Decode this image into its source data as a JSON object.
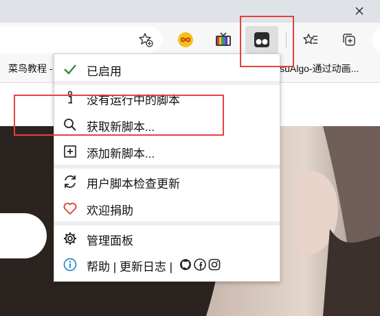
{
  "toolbar": {
    "extension_icons": [
      "favorite-star-plus-icon",
      "infinity-extension-icon",
      "tv-extension-icon",
      "tampermonkey-extension-icon",
      "favorites-icon",
      "collections-icon"
    ]
  },
  "bookmarks": {
    "left": "菜鸟教程 -",
    "right": "isuAlgo-通过动画..."
  },
  "menu": {
    "items": [
      {
        "label": "已启用",
        "icon": "checkmark-icon"
      },
      {
        "label": "没有运行中的脚本",
        "icon": "info-figure-icon"
      },
      {
        "label": "获取新脚本...",
        "icon": "search-icon"
      },
      {
        "label": "添加新脚本...",
        "icon": "plus-box-icon"
      },
      {
        "label": "用户脚本检查更新",
        "icon": "refresh-icon"
      },
      {
        "label": "欢迎捐助",
        "icon": "heart-icon"
      },
      {
        "label": "管理面板",
        "icon": "gear-icon"
      },
      {
        "label": "帮助 | 更新日志 |",
        "icon": "info-circle-icon"
      }
    ]
  },
  "colors": {
    "highlight_red": "#e8403e",
    "check_green": "#2f8a3a",
    "heart_red": "#e0443a",
    "info_blue": "#2d86c8"
  }
}
